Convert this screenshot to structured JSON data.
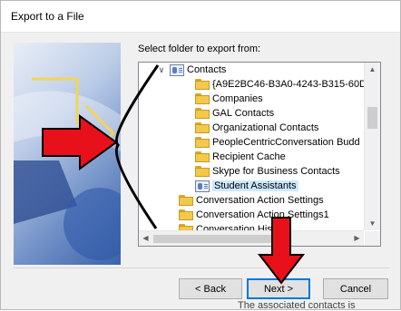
{
  "window": {
    "title": "Export to a File"
  },
  "folder_picker": {
    "label": "Select folder to export from:"
  },
  "tree": {
    "rows": [
      {
        "label": "Contacts",
        "icon": "contact-folder",
        "chevron": "expanded"
      },
      {
        "label": "{A9E2BC46-B3A0-4243-B315-60D",
        "icon": "folder"
      },
      {
        "label": "Companies",
        "icon": "folder"
      },
      {
        "label": "GAL Contacts",
        "icon": "folder"
      },
      {
        "label": "Organizational Contacts",
        "icon": "folder"
      },
      {
        "label": "PeopleCentricConversation Budd",
        "icon": "folder"
      },
      {
        "label": "Recipient Cache",
        "icon": "folder"
      },
      {
        "label": "Skype for Business Contacts",
        "icon": "folder"
      },
      {
        "label": "Student Assistants",
        "icon": "contact-folder",
        "selected": true
      },
      {
        "label": "Conversation Action Settings",
        "icon": "folder"
      },
      {
        "label": "Conversation Action Settings1",
        "icon": "folder"
      },
      {
        "label": "Conversation History",
        "icon": "folder"
      }
    ]
  },
  "buttons": {
    "back": "< Back",
    "next": "Next >",
    "cancel": "Cancel"
  },
  "background_text": {
    "bottom_peek": "The associated contacts is"
  },
  "colors": {
    "accent": "#0078d7",
    "annotation_red": "#e8101a",
    "selection": "#cce8ff"
  }
}
